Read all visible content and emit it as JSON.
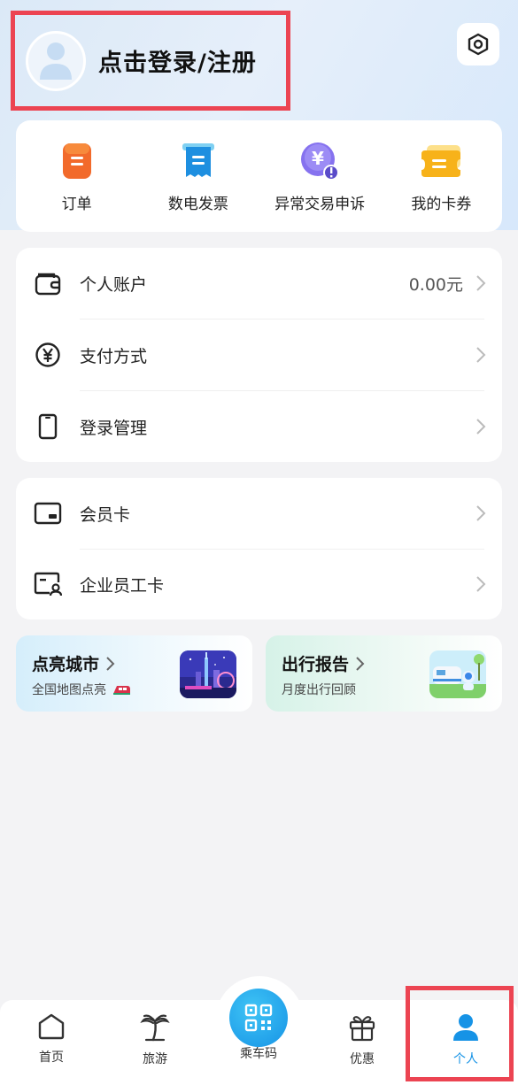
{
  "header": {
    "login_text": "点击登录/注册",
    "icons": {
      "avatar": "avatar-icon",
      "settings": "settings-icon"
    }
  },
  "quick_actions": [
    {
      "label": "订单",
      "icon": "order-icon",
      "color": "#f26a2b"
    },
    {
      "label": "数电发票",
      "icon": "invoice-icon",
      "color": "#1e8fe0"
    },
    {
      "label": "异常交易申诉",
      "icon": "appeal-icon",
      "color": "#7a67e8"
    },
    {
      "label": "我的卡券",
      "icon": "coupon-icon",
      "color": "#f7b21a"
    }
  ],
  "account_list": [
    {
      "label": "个人账户",
      "value": "0.00元",
      "icon": "wallet-icon"
    },
    {
      "label": "支付方式",
      "value": "",
      "icon": "yuan-icon"
    },
    {
      "label": "登录管理",
      "value": "",
      "icon": "phone-icon"
    }
  ],
  "card_list": [
    {
      "label": "会员卡",
      "icon": "member-card-icon"
    },
    {
      "label": "企业员工卡",
      "icon": "employee-card-icon"
    }
  ],
  "promos": [
    {
      "title": "点亮城市",
      "subtitle": "全国地图点亮"
    },
    {
      "title": "出行报告",
      "subtitle": "月度出行回顾"
    }
  ],
  "tabbar": [
    {
      "label": "首页",
      "icon": "home-icon",
      "active": false
    },
    {
      "label": "旅游",
      "icon": "palm-tree-icon",
      "active": false
    },
    {
      "label": "乘车码",
      "icon": "qr-code-icon",
      "active": false
    },
    {
      "label": "优惠",
      "icon": "gift-icon",
      "active": false
    },
    {
      "label": "个人",
      "icon": "person-icon",
      "active": true
    }
  ],
  "colors": {
    "accent": "#1693e6",
    "highlight_box": "#ec4452"
  }
}
